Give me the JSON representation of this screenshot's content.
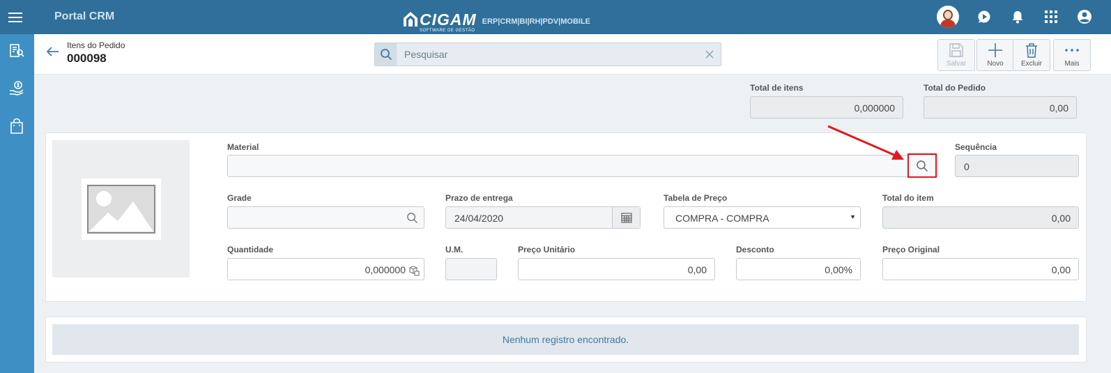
{
  "app": {
    "title": "Portal CRM"
  },
  "logo": {
    "name": "CIGAM",
    "subtitle": "SOFTWARE DE GESTÃO",
    "products": "ERP|CRM|BI|RH|PDV|MOBILE"
  },
  "header": {
    "breadcrumb": "Itens do Pedido",
    "doc_id": "000098",
    "search_placeholder": "Pesquisar"
  },
  "toolbar": {
    "save_label": "Salvar",
    "new_label": "Novo",
    "delete_label": "Excluir",
    "more_label": "Mais"
  },
  "totals": {
    "total_items_label": "Total de itens",
    "total_items_value": "0,000000",
    "total_order_label": "Total do Pedido",
    "total_order_value": "0,00"
  },
  "form": {
    "material_label": "Material",
    "material_value": "",
    "sequence_label": "Sequência",
    "sequence_value": "0",
    "grade_label": "Grade",
    "grade_value": "",
    "delivery_label": "Prazo de entrega",
    "delivery_value": "24/04/2020",
    "price_table_label": "Tabela de Preço",
    "price_table_value": "COMPRA - COMPRA",
    "item_total_label": "Total do item",
    "item_total_value": "0,00",
    "quantity_label": "Quantidade",
    "quantity_value": "0,000000",
    "um_label": "U.M.",
    "um_value": "",
    "unit_price_label": "Preço Unitário",
    "unit_price_value": "0,00",
    "discount_label": "Desconto",
    "discount_value": "0,00%",
    "original_price_label": "Preço Original",
    "original_price_value": "0,00"
  },
  "grid": {
    "empty_message": "Nenhum registro encontrado."
  },
  "colors": {
    "topbar": "#2f6f9a",
    "sidebar": "#3d8fc4",
    "highlight": "#e0191f"
  }
}
